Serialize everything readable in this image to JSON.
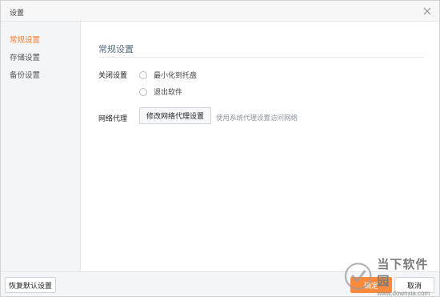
{
  "window": {
    "title": "设置"
  },
  "sidebar": {
    "items": [
      {
        "label": "常规设置",
        "active": true
      },
      {
        "label": "存储设置",
        "active": false
      },
      {
        "label": "备份设置",
        "active": false
      }
    ]
  },
  "main": {
    "section_title": "常规设置",
    "close_setting": {
      "label": "关闭设置",
      "options": [
        "最小化到托盘",
        "退出软件"
      ]
    },
    "proxy": {
      "label": "网络代理",
      "button_label": "修改网络代理设置",
      "hint": "使用系统代理设置访问网络"
    }
  },
  "footer": {
    "restore_label": "恢复默认设置",
    "ok_label": "确定",
    "cancel_label": "取消"
  },
  "watermark": {
    "name": "当下软件园",
    "url": "www.downxia.com"
  },
  "colors": {
    "accent": "#ff7a2f",
    "ok_button": "#ff8a3d",
    "section_title": "#566b80"
  }
}
